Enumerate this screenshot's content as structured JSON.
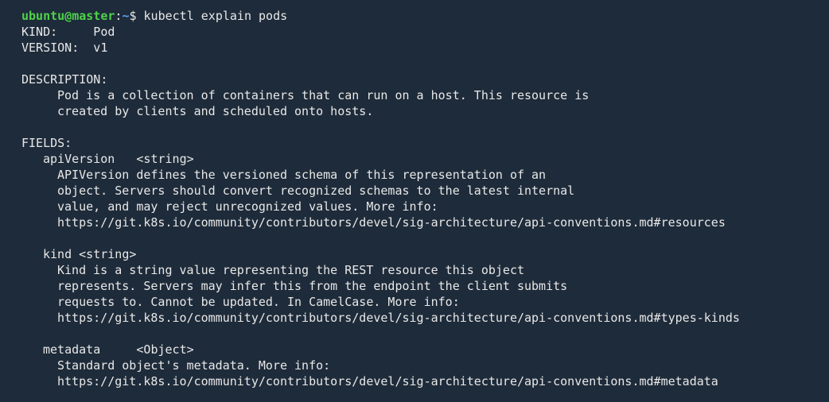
{
  "prompt": {
    "user_host": "ubuntu@master",
    "separator": ":",
    "path": "~",
    "symbol": "$ ",
    "command": "kubectl explain pods"
  },
  "header": {
    "kind_line": "KIND:     Pod",
    "version_line": "VERSION:  v1"
  },
  "description": {
    "heading": "DESCRIPTION:",
    "lines": [
      "Pod is a collection of containers that can run on a host. This resource is",
      "created by clients and scheduled onto hosts."
    ]
  },
  "fields": {
    "heading": "FIELDS:",
    "items": [
      {
        "signature": "apiVersion   <string>",
        "lines": [
          "APIVersion defines the versioned schema of this representation of an",
          "object. Servers should convert recognized schemas to the latest internal",
          "value, and may reject unrecognized values. More info:",
          "https://git.k8s.io/community/contributors/devel/sig-architecture/api-conventions.md#resources"
        ]
      },
      {
        "signature": "kind <string>",
        "lines": [
          "Kind is a string value representing the REST resource this object",
          "represents. Servers may infer this from the endpoint the client submits",
          "requests to. Cannot be updated. In CamelCase. More info:",
          "https://git.k8s.io/community/contributors/devel/sig-architecture/api-conventions.md#types-kinds"
        ]
      },
      {
        "signature": "metadata     <Object>",
        "lines": [
          "Standard object's metadata. More info:",
          "https://git.k8s.io/community/contributors/devel/sig-architecture/api-conventions.md#metadata"
        ]
      }
    ]
  },
  "colors": {
    "background": "#1e2b3a",
    "text": "#e8e8e8",
    "user_host": "#4fd14a",
    "path": "#5a9ff5"
  }
}
